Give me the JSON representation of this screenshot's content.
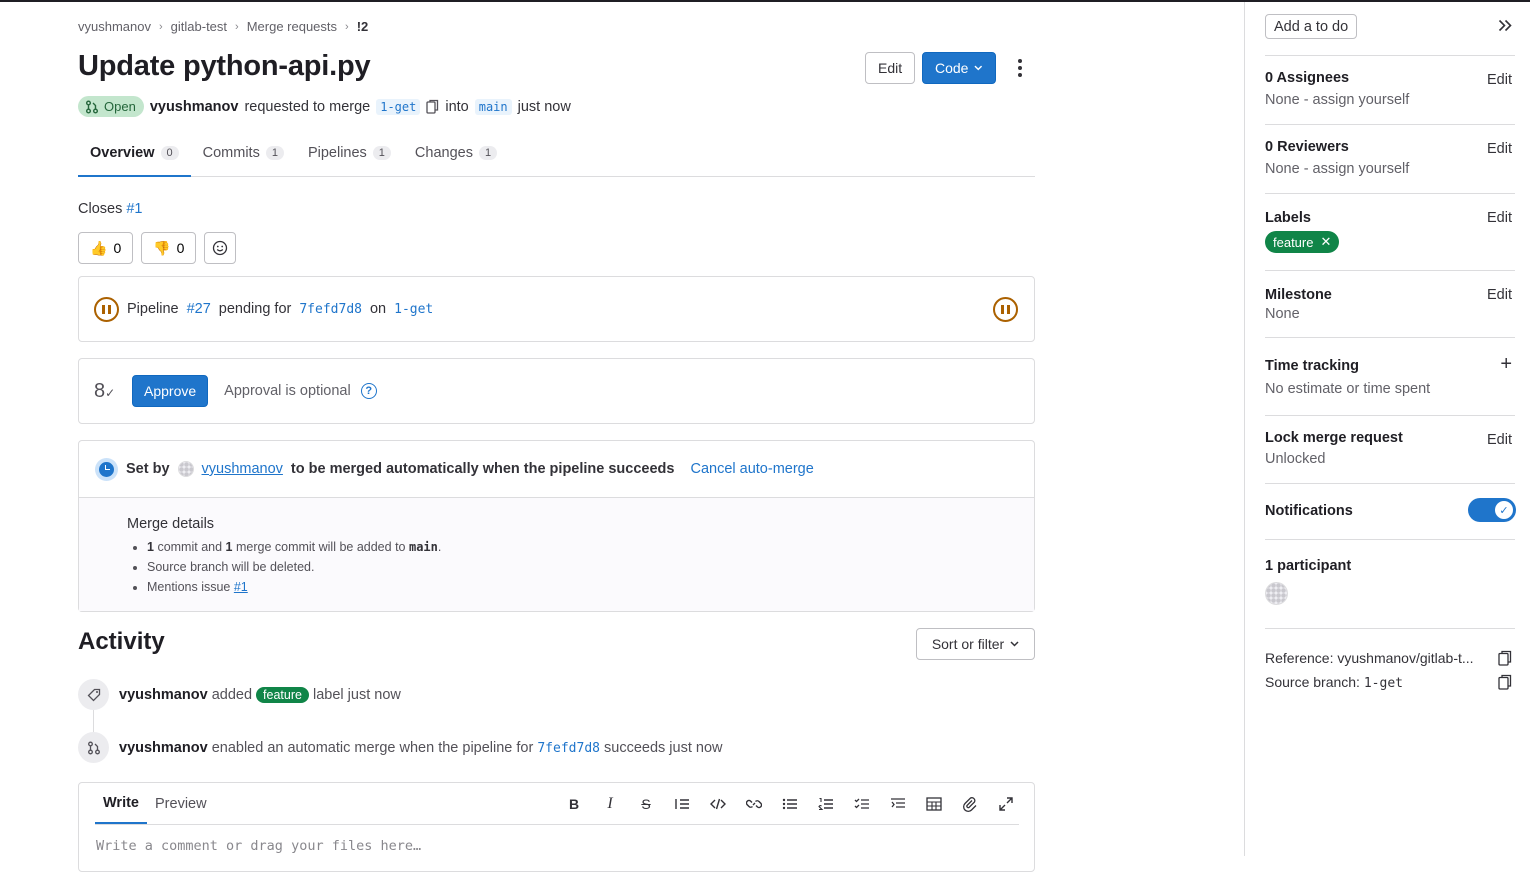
{
  "breadcrumb": [
    "vyushmanov",
    "gitlab-test",
    "Merge requests",
    "!2"
  ],
  "title": "Update python-api.py",
  "header": {
    "edit_label": "Edit",
    "code_label": "Code"
  },
  "meta": {
    "status": "Open",
    "author": "vyushmanov",
    "requested_text": "requested to merge",
    "source_branch": "1-get",
    "into_text": "into",
    "target_branch": "main",
    "time": "just now"
  },
  "tabs": [
    {
      "label": "Overview",
      "count": "0"
    },
    {
      "label": "Commits",
      "count": "1"
    },
    {
      "label": "Pipelines",
      "count": "1"
    },
    {
      "label": "Changes",
      "count": "1"
    }
  ],
  "description": {
    "closes_text": "Closes",
    "issue_ref": "#1"
  },
  "reactions": {
    "thumbs_up": "0",
    "thumbs_down": "0"
  },
  "pipeline": {
    "prefix": "Pipeline",
    "id": "#27",
    "status_text": "pending for",
    "commit": "7fefd7d8",
    "on_text": "on",
    "branch": "1-get"
  },
  "approval": {
    "button": "Approve",
    "text": "Approval is optional"
  },
  "auto_merge": {
    "set_by": "Set by",
    "user": "vyushmanov",
    "text": "to be merged automatically when the pipeline succeeds",
    "cancel": "Cancel auto-merge",
    "details_title": "Merge details",
    "commit_count": "1",
    "commit_text": "commit and",
    "merge_count": "1",
    "merge_text": "merge commit will be added to",
    "target": "main",
    "delete_text": "Source branch will be deleted.",
    "mentions_text": "Mentions issue",
    "mentions_ref": "#1"
  },
  "activity": {
    "title": "Activity",
    "sort_label": "Sort or filter",
    "items": [
      {
        "user": "vyushmanov",
        "action": "added",
        "label": "feature",
        "suffix": "label just now"
      },
      {
        "user": "vyushmanov",
        "action": "enabled an automatic merge when the pipeline for",
        "commit": "7fefd7d8",
        "suffix": "succeeds just now"
      }
    ]
  },
  "editor": {
    "write_tab": "Write",
    "preview_tab": "Preview",
    "placeholder": "Write a comment or drag your files here…"
  },
  "sidebar": {
    "todo": "Add a to do",
    "edit": "Edit",
    "assignees_title": "0 Assignees",
    "assignees_value": "None - assign yourself",
    "reviewers_title": "0 Reviewers",
    "reviewers_value": "None - assign yourself",
    "labels_title": "Labels",
    "label": "feature",
    "milestone_title": "Milestone",
    "milestone_value": "None",
    "time_title": "Time tracking",
    "time_value": "No estimate or time spent",
    "lock_title": "Lock merge request",
    "lock_value": "Unlocked",
    "notifications_title": "Notifications",
    "notifications_on": true,
    "participants_title": "1 participant",
    "reference": "Reference: vyushmanov/gitlab-t...",
    "source_branch_label": "Source branch:",
    "source_branch": "1-get"
  },
  "colors": {
    "accent": "#1f75cb",
    "success": "#108548",
    "warning": "#ab6100"
  }
}
